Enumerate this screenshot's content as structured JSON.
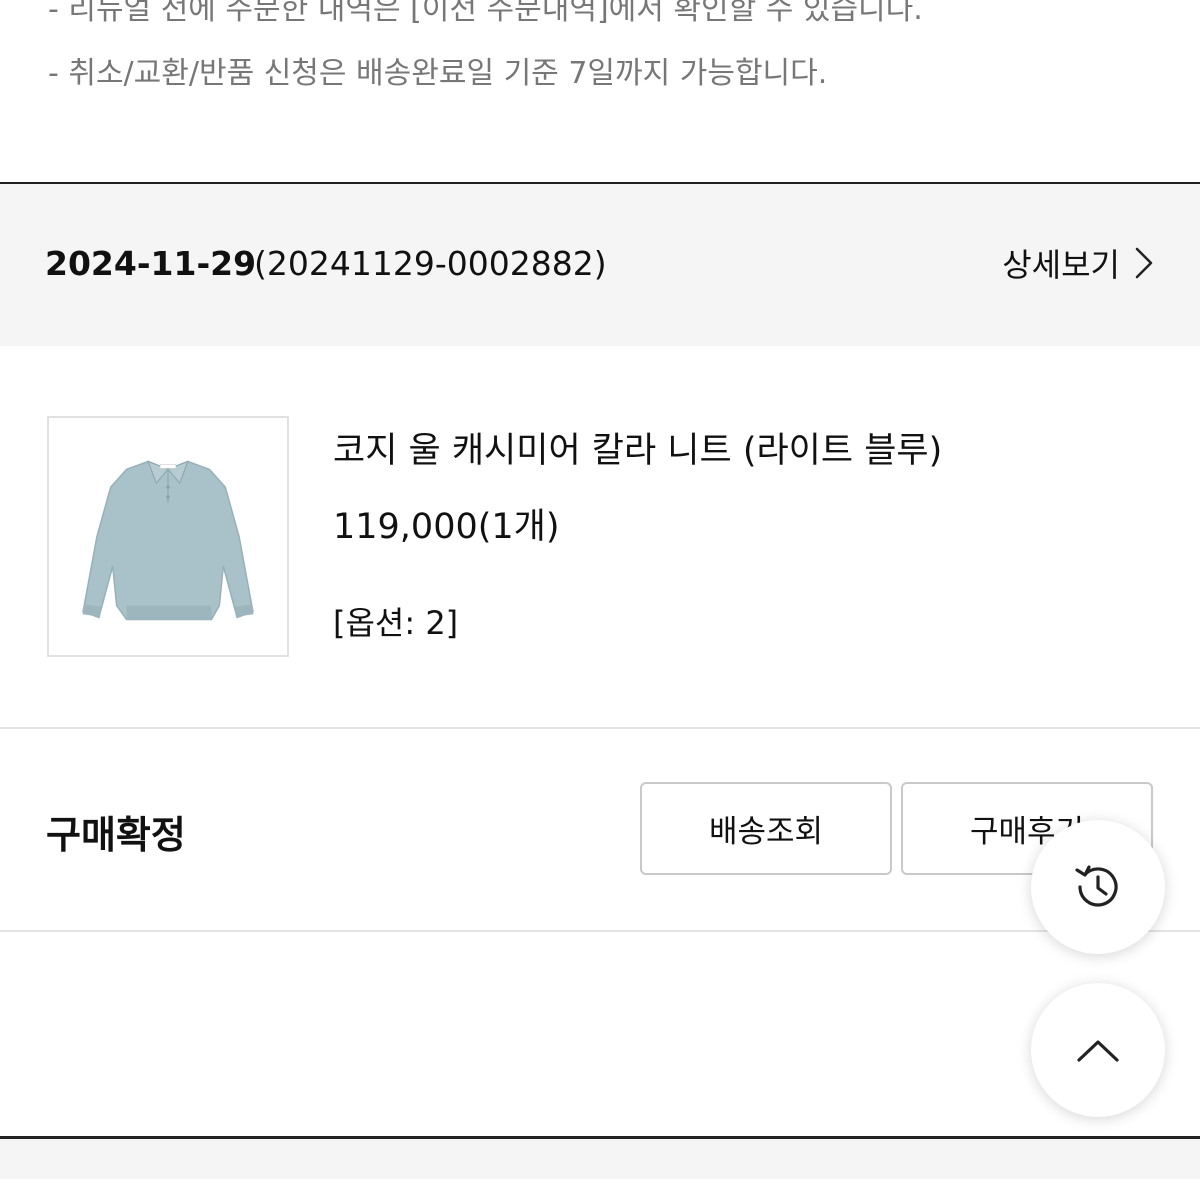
{
  "notices": {
    "line1": "- 리뉴얼 전에 주문한 내역은 [이전 주문내역]에서 확인할 수 있습니다.",
    "line2": "- 취소/교환/반품 신청은 배송완료일 기준 7일까지 가능합니다."
  },
  "order": {
    "date": "2024-11-29",
    "number": "(20241129-0002882)",
    "detail_label": "상세보기",
    "detail_icon": "chevron-right-icon"
  },
  "product": {
    "image_icon": "product-thumbnail",
    "name": "코지 울 캐시미어 칼라 니트 (라이트 블루)",
    "price": "119,000(1개)",
    "option": "[옵션: 2]",
    "color": "#a9c1c8"
  },
  "status": {
    "label": "구매확정",
    "buttons": {
      "track": "배송조회",
      "review": "구매후기"
    }
  },
  "floating": {
    "history_icon": "history-icon",
    "scroll_top_icon": "chevron-up-icon"
  },
  "colors": {
    "band_bg": "#f5f5f5",
    "muted_text": "#777777",
    "border": "#c9c9c9"
  }
}
